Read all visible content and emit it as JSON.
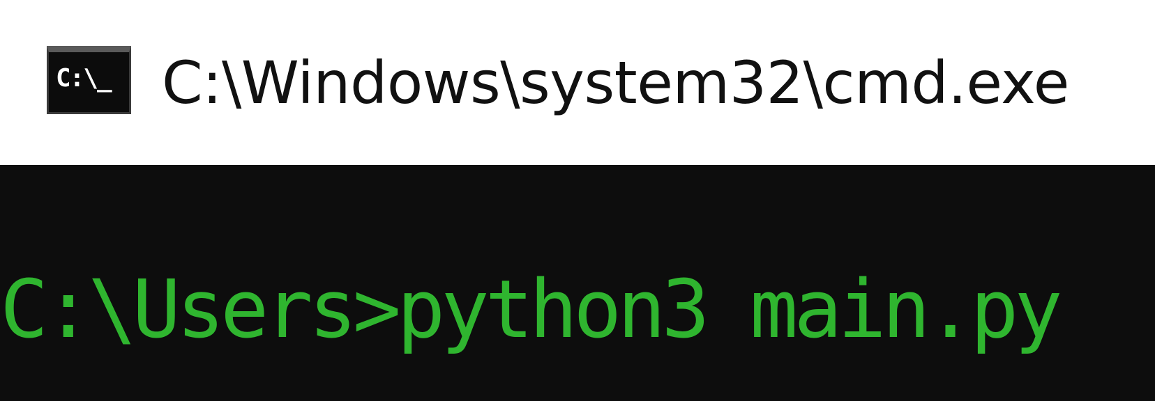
{
  "window": {
    "title": "C:\\Windows\\system32\\cmd.exe",
    "icon": {
      "name": "command-prompt-icon",
      "label": "C:\\_"
    }
  },
  "console": {
    "prompt": "C:\\Users>",
    "command": "python3 main.py",
    "text_color": "#2fb52f",
    "background_color": "#0d0d0d"
  }
}
